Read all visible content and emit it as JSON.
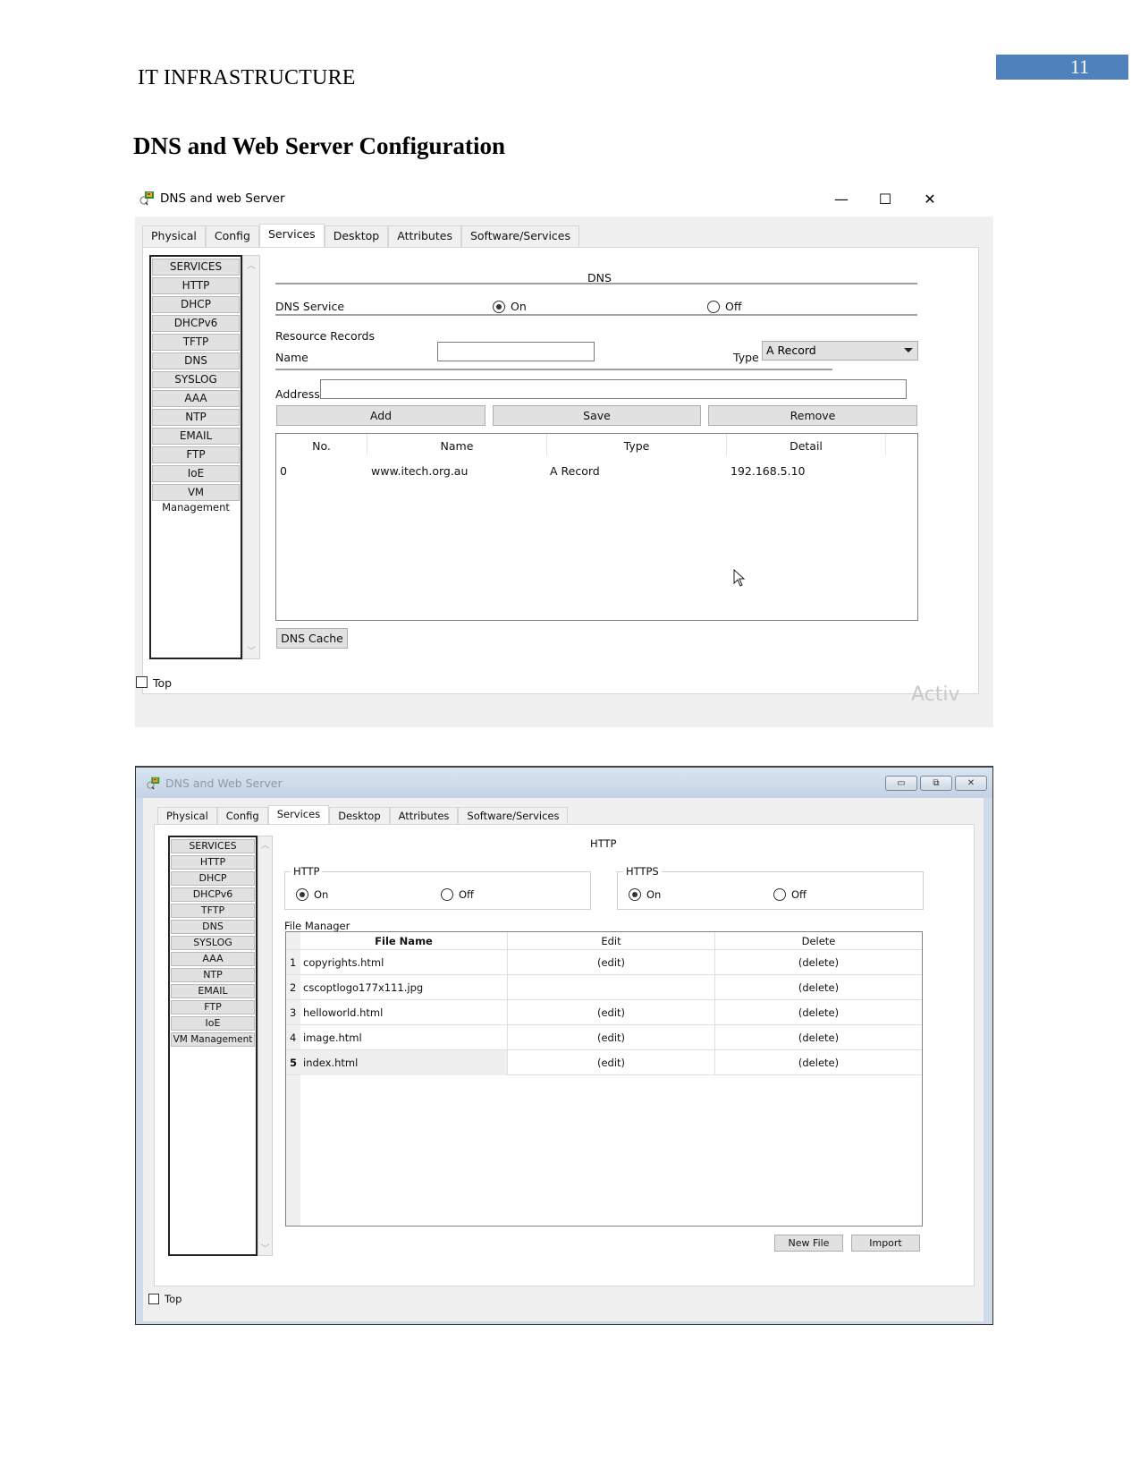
{
  "document": {
    "header": "IT INFRASTRUCTURE",
    "page_number": "11",
    "section_title": "DNS and Web Server Configuration",
    "accent_color": "#4f81bd"
  },
  "window1": {
    "title": "DNS and web Server",
    "controls": {
      "minimize": "—",
      "maximize": "☐",
      "close": "✕"
    },
    "tabs": [
      "Physical",
      "Config",
      "Services",
      "Desktop",
      "Attributes",
      "Software/Services"
    ],
    "active_tab": "Services",
    "services": [
      "SERVICES",
      "HTTP",
      "DHCP",
      "DHCPv6",
      "TFTP",
      "DNS",
      "SYSLOG",
      "AAA",
      "NTP",
      "EMAIL",
      "FTP",
      "IoE",
      "VM Management"
    ],
    "panel": {
      "heading": "DNS",
      "service_label": "DNS Service",
      "on_label": "On",
      "off_label": "Off",
      "service_state": "On",
      "resource_records_label": "Resource Records",
      "name_label": "Name",
      "name_value": "",
      "type_label": "Type",
      "type_value": "A Record",
      "address_label": "Address",
      "address_value": "",
      "buttons": {
        "add": "Add",
        "save": "Save",
        "remove": "Remove",
        "dns_cache": "DNS Cache"
      },
      "table": {
        "columns": [
          "No.",
          "Name",
          "Type",
          "Detail"
        ],
        "rows": [
          {
            "no": "0",
            "name": "www.itech.org.au",
            "type": "A Record",
            "detail": "192.168.5.10"
          }
        ]
      }
    },
    "top_checkbox_label": "Top",
    "top_checked": false,
    "watermark": "Activ"
  },
  "window2": {
    "title": "DNS and Web Server",
    "tabs": [
      "Physical",
      "Config",
      "Services",
      "Desktop",
      "Attributes",
      "Software/Services"
    ],
    "active_tab": "Services",
    "services": [
      "SERVICES",
      "HTTP",
      "DHCP",
      "DHCPv6",
      "TFTP",
      "DNS",
      "SYSLOG",
      "AAA",
      "NTP",
      "EMAIL",
      "FTP",
      "IoE",
      "VM Management"
    ],
    "panel": {
      "heading": "HTTP",
      "http": {
        "legend": "HTTP",
        "on_label": "On",
        "off_label": "Off",
        "state": "On"
      },
      "https": {
        "legend": "HTTPS",
        "on_label": "On",
        "off_label": "Off",
        "state": "On"
      },
      "file_manager_label": "File Manager",
      "table": {
        "columns": [
          "File Name",
          "Edit",
          "Delete"
        ],
        "rows": [
          {
            "index": "1",
            "file": "copyrights.html",
            "edit": "(edit)",
            "delete": "(delete)"
          },
          {
            "index": "2",
            "file": "cscoptlogo177x111.jpg",
            "edit": "",
            "delete": "(delete)"
          },
          {
            "index": "3",
            "file": "helloworld.html",
            "edit": "(edit)",
            "delete": "(delete)"
          },
          {
            "index": "4",
            "file": "image.html",
            "edit": "(edit)",
            "delete": "(delete)"
          },
          {
            "index": "5",
            "file": "index.html",
            "edit": "(edit)",
            "delete": "(delete)"
          }
        ],
        "selected_row": "5"
      },
      "buttons": {
        "new_file": "New File",
        "import": "Import"
      }
    },
    "top_checkbox_label": "Top",
    "top_checked": false
  }
}
